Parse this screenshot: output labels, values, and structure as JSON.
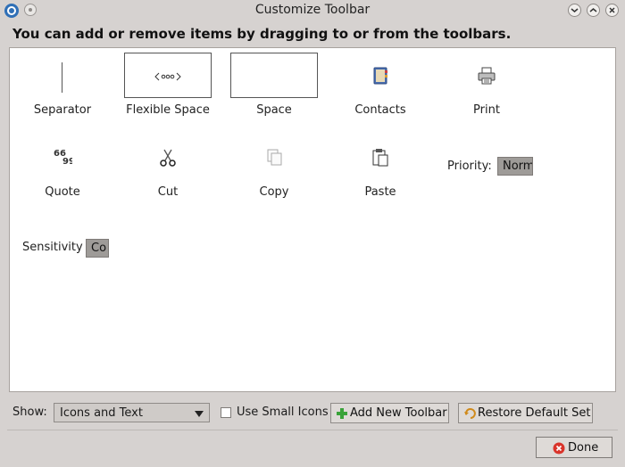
{
  "window": {
    "title": "Customize Toolbar"
  },
  "heading": "You can add or remove items by dragging to or from the toolbars.",
  "palette": {
    "items": [
      {
        "label": "Separator",
        "icon": "separator-icon"
      },
      {
        "label": "Flexible Space",
        "icon": "flexible-space-icon"
      },
      {
        "label": "Space",
        "icon": "space-icon"
      },
      {
        "label": "Contacts",
        "icon": "address-book-icon"
      },
      {
        "label": "Print",
        "icon": "printer-icon"
      },
      {
        "label": "Quote",
        "icon": "quote-icon"
      },
      {
        "label": "Cut",
        "icon": "scissors-icon"
      },
      {
        "label": "Copy",
        "icon": "copy-icon"
      },
      {
        "label": "Paste",
        "icon": "paste-icon"
      }
    ],
    "priority": {
      "label": "Priority:",
      "value": "Norm"
    },
    "sensitivity": {
      "label": "Sensitivity",
      "value": "Co"
    }
  },
  "bottom": {
    "show_label": "Show:",
    "show_value": "Icons and Text",
    "small_icons_label": "Use Small Icons",
    "small_icons_checked": false,
    "add_toolbar_label": "Add New Toolbar",
    "restore_label": "Restore Default Set",
    "done_label": "Done"
  },
  "colors": {
    "window_bg": "#d6d2d0",
    "palette_bg": "#ffffff",
    "add_icon": "#3aa33a",
    "done_icon": "#d9342b"
  }
}
